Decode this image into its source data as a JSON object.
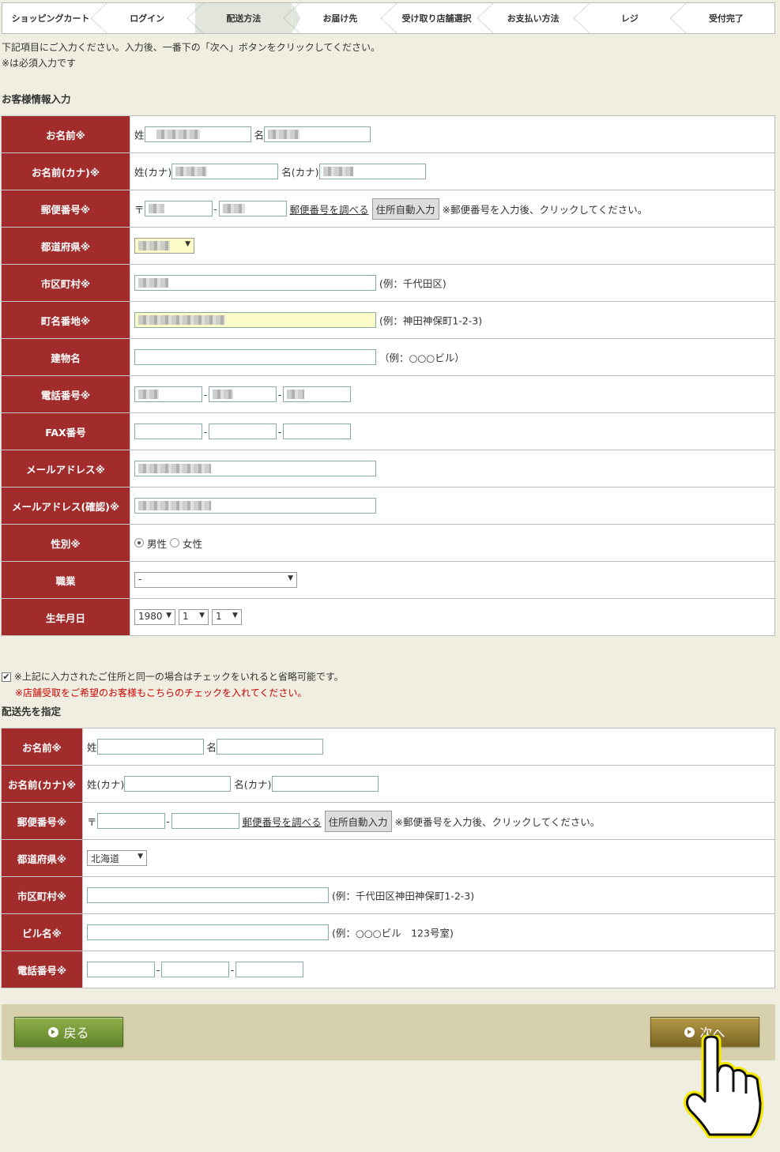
{
  "steps": [
    "ショッピングカート",
    "ログイン",
    "配送方法",
    "お届け先",
    "受け取り店舗選択",
    "お支払い方法",
    "レジ",
    "受付完了"
  ],
  "intro": {
    "line1": "下記項目にご入力ください。入力後、一番下の「次へ」ボタンをクリックしてください。",
    "line2": "※は必須入力です"
  },
  "customer": {
    "title": "お客様情報入力",
    "name_label": "お名前※",
    "sei": "姓",
    "mei": "名",
    "kana_label": "お名前(カナ)※",
    "sei_kana": "姓(カナ)",
    "mei_kana": "名(カナ)",
    "zip_label": "郵便番号※",
    "zip_mark": "〒",
    "zip_lookup": "郵便番号を調べる",
    "zip_auto": "住所自動入力",
    "zip_note": "※郵便番号を入力後、クリックしてください。",
    "pref_label": "都道府県※",
    "city_label": "市区町村※",
    "city_example": "(例：千代田区)",
    "street_label": "町名番地※",
    "street_example": "(例：神田神保町1-2-3)",
    "building_label": "建物名",
    "building_example": "（例：○○○ビル）",
    "tel_label": "電話番号※",
    "fax_label": "FAX番号",
    "email_label": "メールアドレス※",
    "email_confirm_label": "メールアドレス(確認)※",
    "gender_label": "性別※",
    "male": "男性",
    "female": "女性",
    "job_label": "職業",
    "job_value": "-",
    "birth_label": "生年月日",
    "birth_year": "1980",
    "birth_month": "1",
    "birth_day": "1"
  },
  "same_address": {
    "note": "※上記に入力されたご住所と同一の場合はチェックをいれると省略可能です。",
    "note_red": "※店舗受取をご希望のお客様もこちらのチェックを入れてください。",
    "checked": "✔"
  },
  "delivery": {
    "title": "配送先を指定",
    "name_label": "お名前※",
    "sei": "姓",
    "mei": "名",
    "kana_label": "お名前(カナ)※",
    "sei_kana": "姓(カナ)",
    "mei_kana": "名(カナ)",
    "zip_label": "郵便番号※",
    "zip_mark": "〒",
    "zip_lookup": "郵便番号を調べる",
    "zip_auto": "住所自動入力",
    "zip_note": "※郵便番号を入力後、クリックしてください。",
    "pref_label": "都道府県※",
    "pref_value": "北海道",
    "city_label": "市区町村※",
    "city_example": "(例：千代田区神田神保町1-2-3)",
    "building_label": "ビル名※",
    "building_example": "(例：○○○ビル　123号室)",
    "tel_label": "電話番号※"
  },
  "footer": {
    "back": "戻る",
    "next": "次へ"
  },
  "icons": {
    "dropdown": "▼"
  }
}
